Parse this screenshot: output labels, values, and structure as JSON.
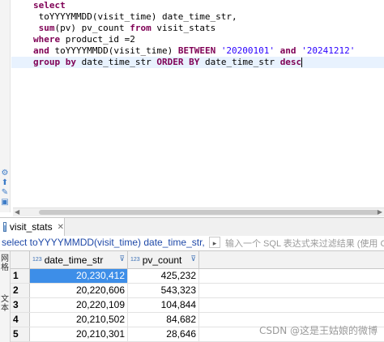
{
  "editor": {
    "lines": [
      [
        {
          "t": "select",
          "c": "kw"
        }
      ],
      [
        {
          "t": " toYYYYMMDD(visit_time) date_time_str,",
          "c": ""
        }
      ],
      [
        {
          "t": " sum",
          "c": "kw"
        },
        {
          "t": "(pv) pv_count ",
          "c": ""
        },
        {
          "t": "from",
          "c": "kw"
        },
        {
          "t": " visit_stats",
          "c": ""
        }
      ],
      [
        {
          "t": "where",
          "c": "kw"
        },
        {
          "t": " product_id =2",
          "c": ""
        }
      ],
      [
        {
          "t": "and",
          "c": "kw"
        },
        {
          "t": " toYYYYMMDD(visit_time) ",
          "c": ""
        },
        {
          "t": "BETWEEN",
          "c": "kw"
        },
        {
          "t": " ",
          "c": ""
        },
        {
          "t": "'20200101'",
          "c": "str"
        },
        {
          "t": " ",
          "c": ""
        },
        {
          "t": "and",
          "c": "kw"
        },
        {
          "t": " ",
          "c": ""
        },
        {
          "t": "'20241212'",
          "c": "str"
        }
      ],
      [
        {
          "t": "group",
          "c": "kw"
        },
        {
          "t": " ",
          "c": ""
        },
        {
          "t": "by",
          "c": "kw"
        },
        {
          "t": " date_time_str ",
          "c": ""
        },
        {
          "t": "ORDER",
          "c": "kw"
        },
        {
          "t": " ",
          "c": ""
        },
        {
          "t": "BY",
          "c": "kw"
        },
        {
          "t": " date_time_str ",
          "c": ""
        },
        {
          "t": "desc",
          "c": "kw"
        }
      ]
    ],
    "gutter_icons": [
      "gear-icon",
      "export-icon",
      "edit-icon",
      "lock-icon",
      "copy-icon"
    ]
  },
  "tab": {
    "label": "visit_stats",
    "close": "✕"
  },
  "filter": {
    "query": "select toYYYYMMDD(visit_time) date_time_str, s",
    "placeholder": "输入一个 SQL 表达式来过滤结果 (使用 Ctrl"
  },
  "side_panel": {
    "labels": [
      "网格",
      "文本"
    ]
  },
  "table": {
    "columns": [
      {
        "name": "date_time_str",
        "type_icon": "123"
      },
      {
        "name": "pv_count",
        "type_icon": "123"
      }
    ],
    "rows": [
      {
        "num": "1",
        "date_time_str": "20,230,412",
        "pv_count": "425,232"
      },
      {
        "num": "2",
        "date_time_str": "20,220,606",
        "pv_count": "543,323"
      },
      {
        "num": "3",
        "date_time_str": "20,220,109",
        "pv_count": "104,844"
      },
      {
        "num": "4",
        "date_time_str": "20,210,502",
        "pv_count": "84,682"
      },
      {
        "num": "5",
        "date_time_str": "20,210,301",
        "pv_count": "28,646"
      }
    ],
    "selected_row": 0
  },
  "watermark": "CSDN @这是王姑娘的微博",
  "colors": {
    "keyword": "#7f0055",
    "string": "#2a00ff",
    "selection": "#3d8ee8"
  }
}
